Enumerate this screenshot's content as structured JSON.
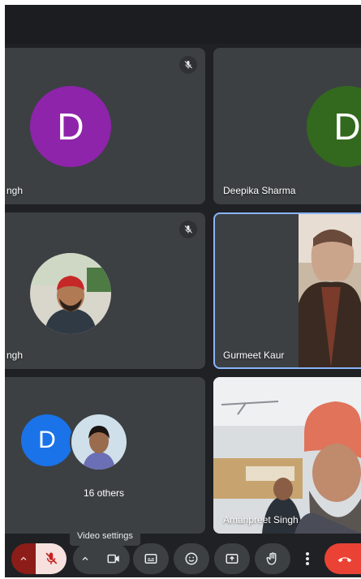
{
  "participants": [
    {
      "name": "ngh",
      "avatar_letter": "D",
      "avatar_color": "#8e24aa",
      "muted": true
    },
    {
      "name": "Deepika Sharma",
      "avatar_letter": "D",
      "avatar_color": "#33691e",
      "muted": false
    },
    {
      "name": "ngh",
      "avatar": "photo",
      "muted": true
    },
    {
      "name": "Gurmeet Kaur",
      "video": true,
      "speaking": true
    },
    {
      "others_count_label": "16 others",
      "avatar_letter": "D",
      "avatar_color": "#1a73e8"
    },
    {
      "name": "Amanpreet Singh",
      "video": true
    }
  ],
  "tooltip": "Video settings",
  "controls": [
    {
      "icon": "chevron-up-icon",
      "kind": "audio-options"
    },
    {
      "icon": "mic-off-icon",
      "kind": "microphone",
      "state": "off"
    },
    {
      "icon": "chevron-up-icon",
      "kind": "video-options"
    },
    {
      "icon": "camera-icon",
      "kind": "camera"
    },
    {
      "icon": "captions-icon",
      "kind": "captions"
    },
    {
      "icon": "emoji-icon",
      "kind": "reactions"
    },
    {
      "icon": "present-icon",
      "kind": "present-screen"
    },
    {
      "icon": "raise-hand-icon",
      "kind": "raise-hand"
    },
    {
      "icon": "more-vert-icon",
      "kind": "more-options"
    },
    {
      "icon": "end-call-icon",
      "kind": "leave-call"
    }
  ],
  "colors": {
    "accent": "#8ab4f8",
    "end_call": "#ea4335",
    "mic_off_bg": "#f6e1df",
    "mic_off_icon": "#c5221f"
  }
}
